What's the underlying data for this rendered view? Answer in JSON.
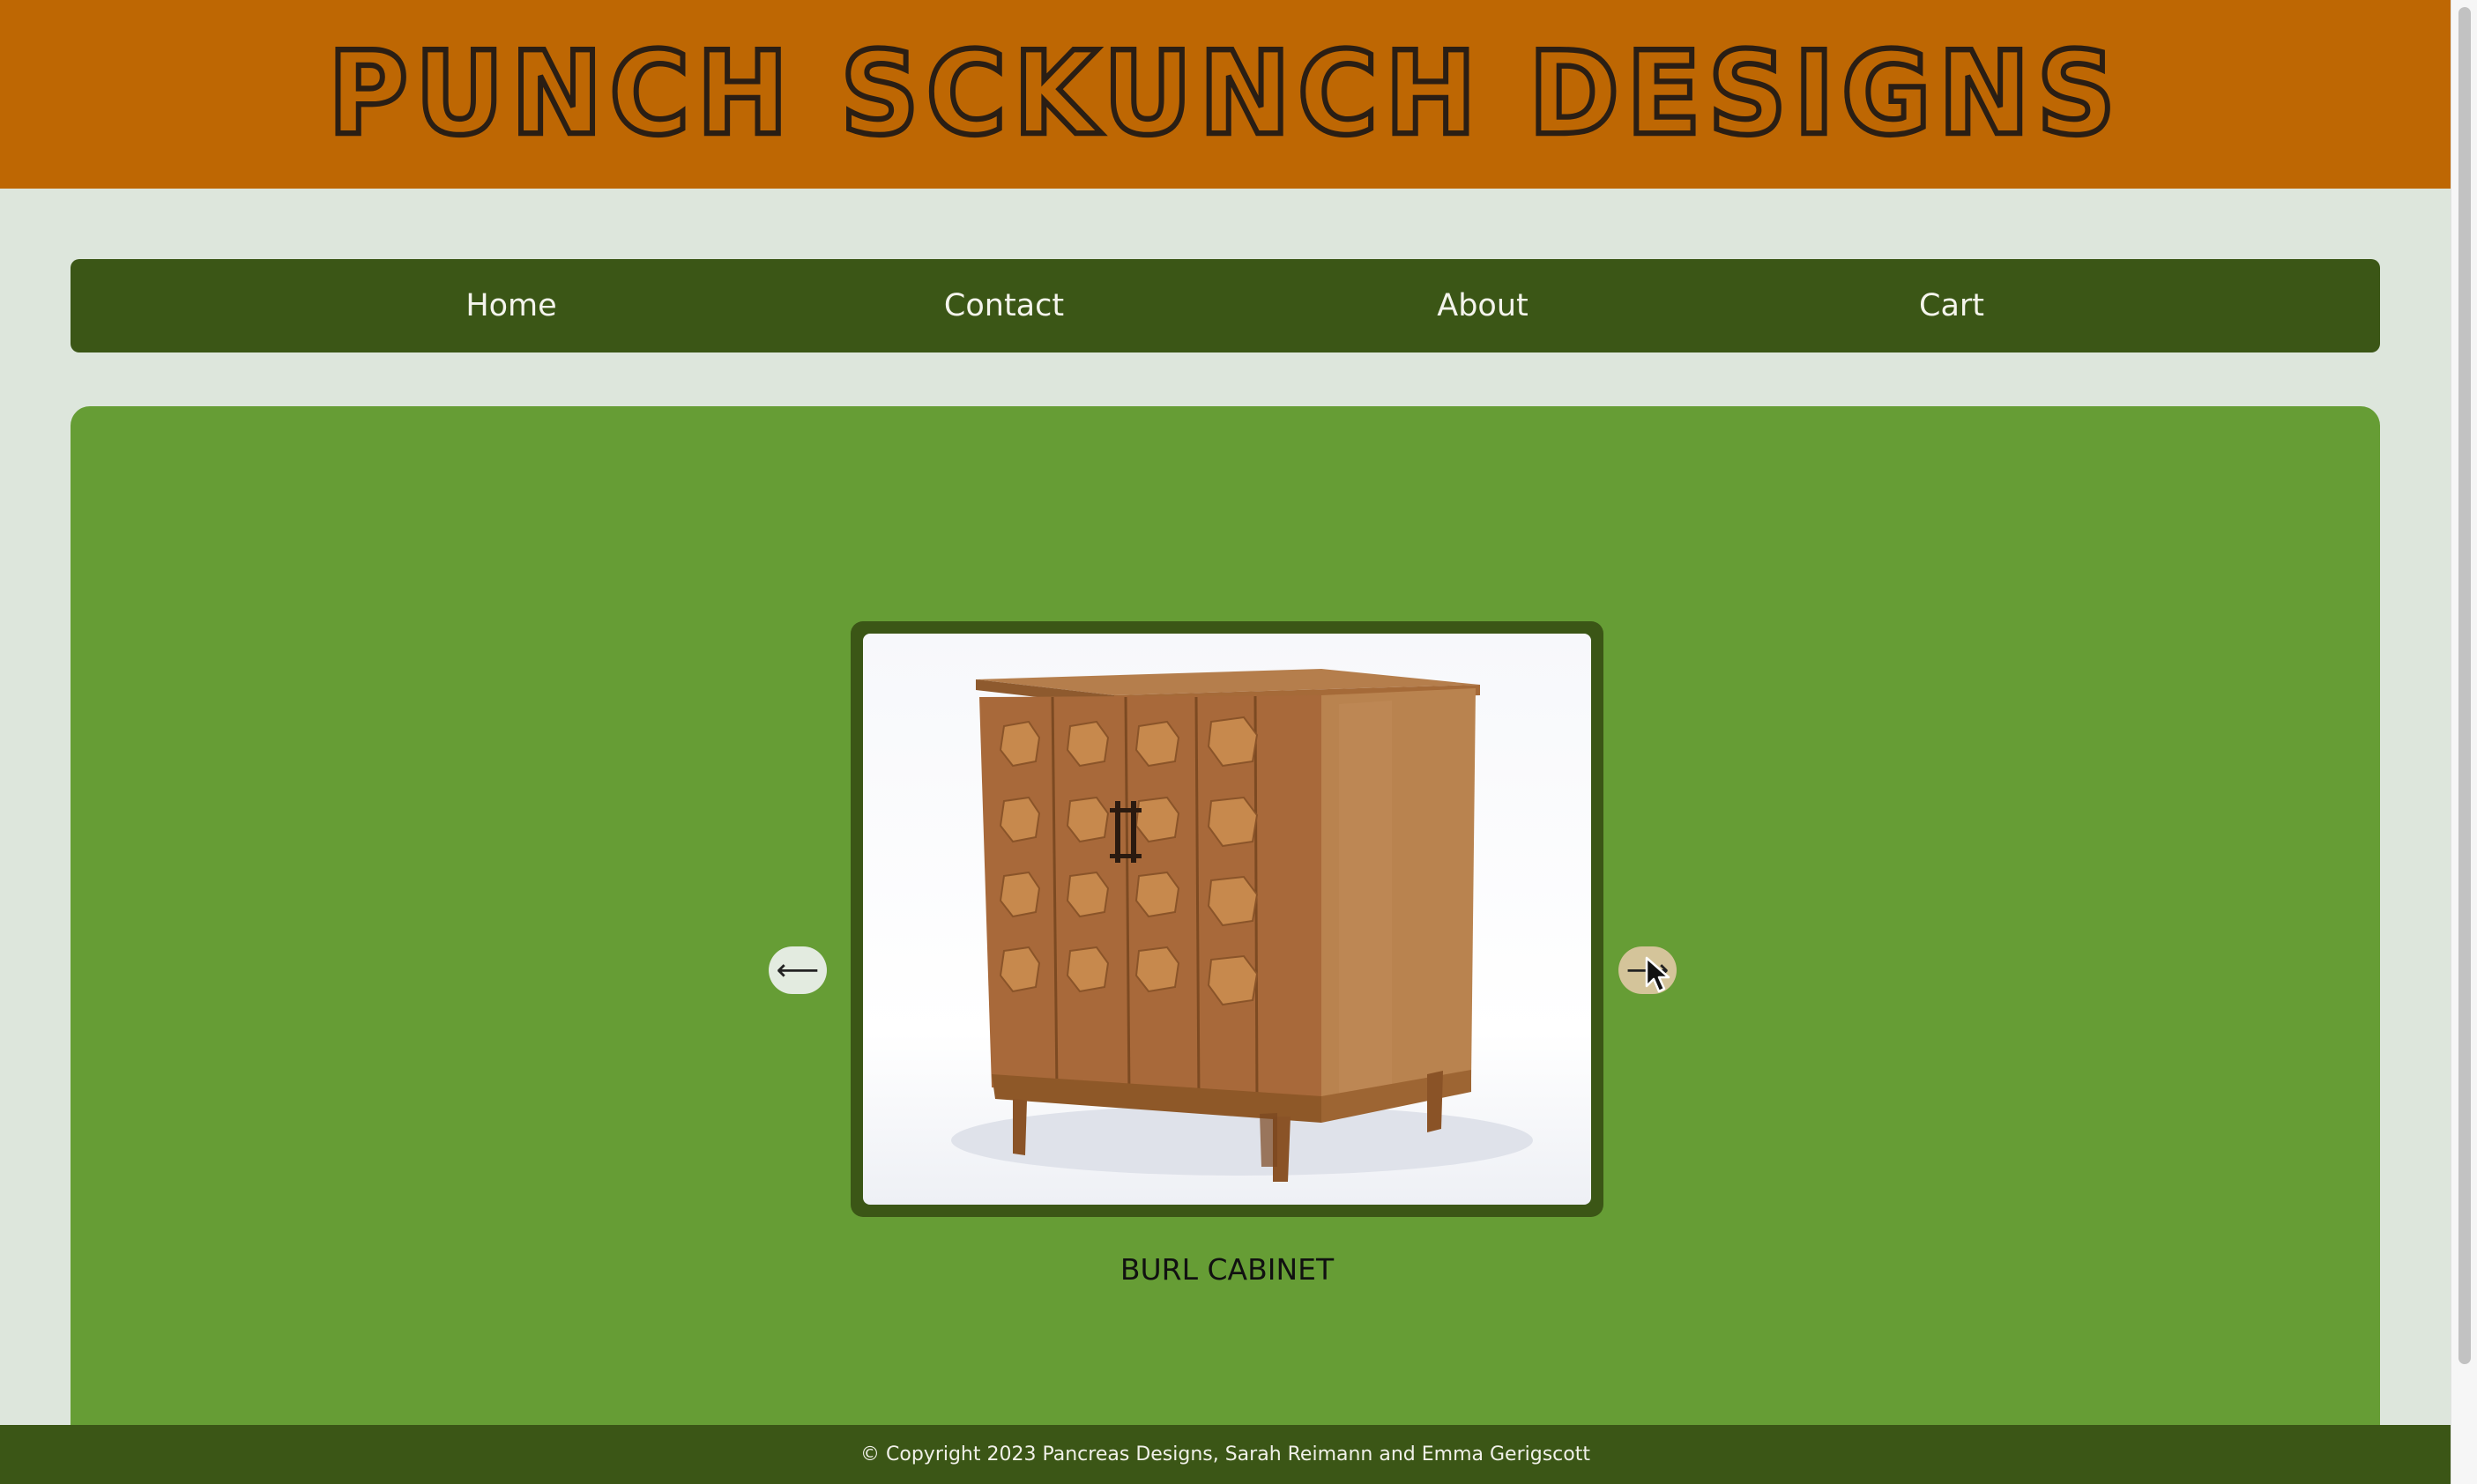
{
  "header": {
    "title": "PUNCH SCKUNCH DESIGNS"
  },
  "nav": {
    "items": [
      "Home",
      "Contact",
      "About",
      "Cart"
    ]
  },
  "carousel": {
    "prev_symbol": "⟵",
    "next_symbol": "⟶",
    "caption": "BURL CABINET",
    "image_subject": "burl-wood cabinet"
  },
  "footer": {
    "copyright": "© Copyright 2023 Pancreas Designs, Sarah Reimann and Emma Gerigscott"
  },
  "colors": {
    "header_bg": "#be6703",
    "nav_bg": "#3b5616",
    "main_bg": "#669d35",
    "page_bg": "#dde6dc"
  }
}
